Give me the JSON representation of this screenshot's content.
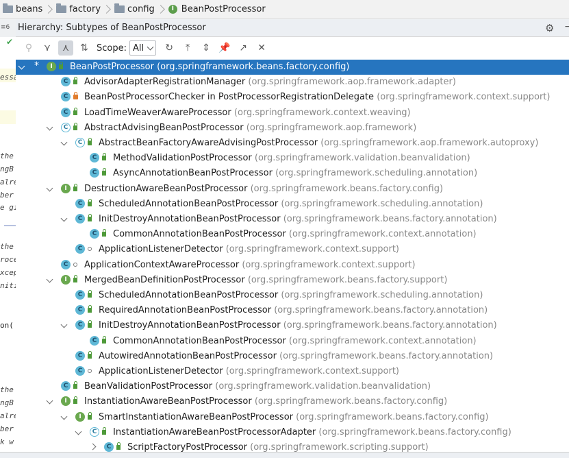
{
  "breadcrumb": [
    {
      "label": "beans",
      "icon": "folder-icon"
    },
    {
      "label": "factory",
      "icon": "folder-icon"
    },
    {
      "label": "config",
      "icon": "folder-icon"
    },
    {
      "label": "BeanPostProcessor",
      "icon": "interface-icon"
    }
  ],
  "gutter": {
    "line_count": "6"
  },
  "editor_fragments": [
    "essa",
    "the",
    "ngB",
    "alre",
    "ber",
    "e gi",
    "the",
    "roce",
    "xcep",
    "niti",
    "on(",
    "the",
    "ngB",
    "alre",
    "ber",
    "k w"
  ],
  "panel": {
    "title": "Hierarchy:  Subtypes of BeanPostProcessor",
    "scope_label": "Scope:",
    "scope_value": "All"
  },
  "tree": [
    {
      "name": "BeanPostProcessor",
      "pkg": "(org.springframework.beans.factory.config)",
      "type": "interface",
      "vis": "public",
      "depth": 0,
      "expand": "down",
      "selected": true,
      "star": true
    },
    {
      "name": "AdvisorAdapterRegistrationManager",
      "pkg": "(org.springframework.aop.framework.adapter)",
      "type": "class",
      "vis": "public",
      "depth": 1
    },
    {
      "name": "BeanPostProcessorChecker in PostProcessorRegistrationDelegate",
      "pkg": "(org.springframework.context.support)",
      "type": "class",
      "vis": "private",
      "depth": 1
    },
    {
      "name": "LoadTimeWeaverAwareProcessor",
      "pkg": "(org.springframework.context.weaving)",
      "type": "class",
      "vis": "public",
      "depth": 1
    },
    {
      "name": "AbstractAdvisingBeanPostProcessor",
      "pkg": "(org.springframework.aop.framework)",
      "type": "abstract",
      "vis": "public",
      "depth": 1,
      "expand": "down"
    },
    {
      "name": "AbstractBeanFactoryAwareAdvisingPostProcessor",
      "pkg": "(org.springframework.aop.framework.autoproxy)",
      "type": "abstract",
      "vis": "public",
      "depth": 2,
      "expand": "down"
    },
    {
      "name": "MethodValidationPostProcessor",
      "pkg": "(org.springframework.validation.beanvalidation)",
      "type": "class",
      "vis": "public",
      "depth": 3
    },
    {
      "name": "AsyncAnnotationBeanPostProcessor",
      "pkg": "(org.springframework.scheduling.annotation)",
      "type": "class",
      "vis": "public",
      "depth": 3
    },
    {
      "name": "DestructionAwareBeanPostProcessor",
      "pkg": "(org.springframework.beans.factory.config)",
      "type": "interface",
      "vis": "public",
      "depth": 1,
      "expand": "down"
    },
    {
      "name": "ScheduledAnnotationBeanPostProcessor",
      "pkg": "(org.springframework.scheduling.annotation)",
      "type": "class",
      "vis": "public",
      "depth": 2
    },
    {
      "name": "InitDestroyAnnotationBeanPostProcessor",
      "pkg": "(org.springframework.beans.factory.annotation)",
      "type": "class",
      "vis": "public",
      "depth": 2,
      "expand": "down"
    },
    {
      "name": "CommonAnnotationBeanPostProcessor",
      "pkg": "(org.springframework.context.annotation)",
      "type": "class",
      "vis": "public",
      "depth": 3
    },
    {
      "name": "ApplicationListenerDetector",
      "pkg": "(org.springframework.context.support)",
      "type": "class",
      "vis": "package",
      "depth": 2
    },
    {
      "name": "ApplicationContextAwareProcessor",
      "pkg": "(org.springframework.context.support)",
      "type": "class",
      "vis": "package",
      "depth": 1
    },
    {
      "name": "MergedBeanDefinitionPostProcessor",
      "pkg": "(org.springframework.beans.factory.support)",
      "type": "interface",
      "vis": "public",
      "depth": 1,
      "expand": "down"
    },
    {
      "name": "ScheduledAnnotationBeanPostProcessor",
      "pkg": "(org.springframework.scheduling.annotation)",
      "type": "class",
      "vis": "public",
      "depth": 2
    },
    {
      "name": "RequiredAnnotationBeanPostProcessor",
      "pkg": "(org.springframework.beans.factory.annotation)",
      "type": "class",
      "vis": "public",
      "depth": 2
    },
    {
      "name": "InitDestroyAnnotationBeanPostProcessor",
      "pkg": "(org.springframework.beans.factory.annotation)",
      "type": "class",
      "vis": "public",
      "depth": 2,
      "expand": "down"
    },
    {
      "name": "CommonAnnotationBeanPostProcessor",
      "pkg": "(org.springframework.context.annotation)",
      "type": "class",
      "vis": "public",
      "depth": 3
    },
    {
      "name": "AutowiredAnnotationBeanPostProcessor",
      "pkg": "(org.springframework.beans.factory.annotation)",
      "type": "class",
      "vis": "public",
      "depth": 2
    },
    {
      "name": "ApplicationListenerDetector",
      "pkg": "(org.springframework.context.support)",
      "type": "class",
      "vis": "package",
      "depth": 2
    },
    {
      "name": "BeanValidationPostProcessor",
      "pkg": "(org.springframework.validation.beanvalidation)",
      "type": "class",
      "vis": "public",
      "depth": 1
    },
    {
      "name": "InstantiationAwareBeanPostProcessor",
      "pkg": "(org.springframework.beans.factory.config)",
      "type": "interface",
      "vis": "public",
      "depth": 1,
      "expand": "down"
    },
    {
      "name": "SmartInstantiationAwareBeanPostProcessor",
      "pkg": "(org.springframework.beans.factory.config)",
      "type": "interface",
      "vis": "public",
      "depth": 2,
      "expand": "down"
    },
    {
      "name": "InstantiationAwareBeanPostProcessorAdapter",
      "pkg": "(org.springframework.beans.factory.config)",
      "type": "abstract",
      "vis": "public",
      "depth": 3,
      "expand": "down"
    },
    {
      "name": "ScriptFactoryPostProcessor",
      "pkg": "(org.springframework.scripting.support)",
      "type": "class",
      "vis": "public",
      "depth": 4,
      "expand": "right"
    }
  ]
}
